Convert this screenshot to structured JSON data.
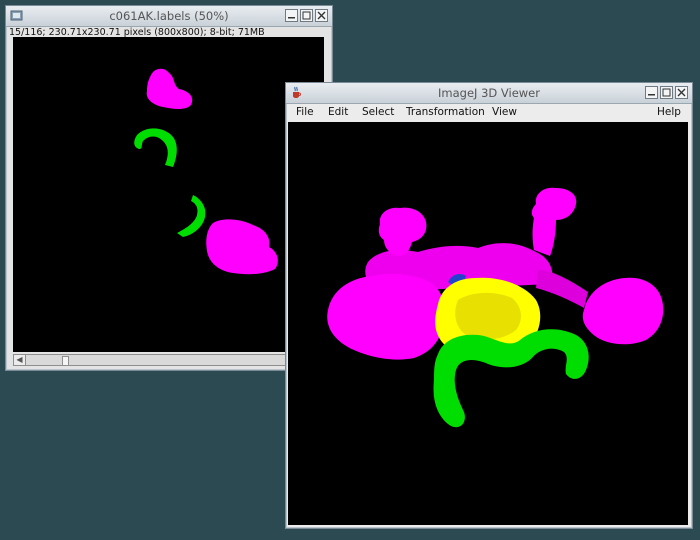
{
  "left_window": {
    "title": "c061AK.labels (50%)",
    "info": "15/116; 230.71x230.71 pixels (800x800); 8-bit; 71MB"
  },
  "right_window": {
    "title": "ImageJ 3D Viewer",
    "menu": {
      "file": "File",
      "edit": "Edit",
      "select": "Select",
      "transformation": "Transformation",
      "view": "View",
      "help": "Help"
    }
  },
  "colors": {
    "magenta": "#ff00ff",
    "green": "#00dd00",
    "yellow": "#ffff00",
    "desktop": "#2c4a52"
  },
  "icons": [
    "image-window-icon",
    "java-cup-icon",
    "minimize-icon",
    "maximize-icon",
    "close-icon",
    "scroll-left-arrow-icon"
  ]
}
